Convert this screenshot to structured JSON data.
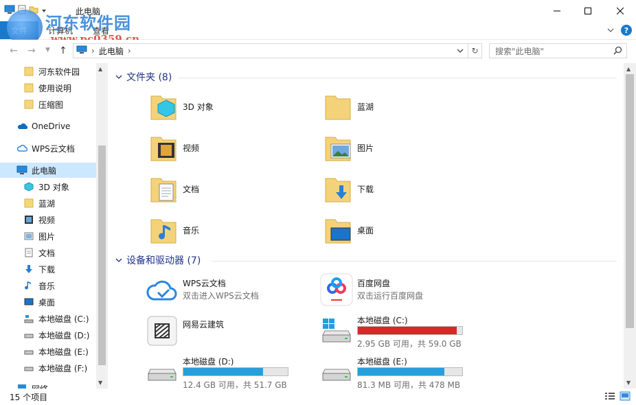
{
  "window": {
    "title": "此电脑"
  },
  "ribbon": {
    "file_tab": "文件",
    "tabs": [
      "计算机",
      "查看"
    ]
  },
  "watermark": {
    "name": "河东软件园",
    "url": "www.pc0359.cn"
  },
  "address": {
    "crumb": "此电脑",
    "search_placeholder": "搜索\"此电脑\""
  },
  "sidebar": {
    "items": [
      {
        "label": "河东软件园",
        "icon": "folder-icon"
      },
      {
        "label": "使用说明",
        "icon": "folder-icon"
      },
      {
        "label": "压缩图",
        "icon": "folder-icon"
      },
      {
        "label": "OneDrive",
        "icon": "onedrive-icon"
      },
      {
        "label": "WPS云文档",
        "icon": "wps-cloud-icon"
      },
      {
        "label": "此电脑",
        "icon": "computer-icon"
      },
      {
        "label": "3D 对象",
        "icon": "3d-objects-icon"
      },
      {
        "label": "蓝湖",
        "icon": "folder-icon"
      },
      {
        "label": "视频",
        "icon": "videos-icon"
      },
      {
        "label": "图片",
        "icon": "pictures-icon"
      },
      {
        "label": "文档",
        "icon": "documents-icon"
      },
      {
        "label": "下载",
        "icon": "downloads-icon"
      },
      {
        "label": "音乐",
        "icon": "music-icon"
      },
      {
        "label": "桌面",
        "icon": "desktop-icon"
      },
      {
        "label": "本地磁盘 (C:)",
        "icon": "drive-c-icon"
      },
      {
        "label": "本地磁盘 (D:)",
        "icon": "drive-icon"
      },
      {
        "label": "本地磁盘 (E:)",
        "icon": "drive-icon"
      },
      {
        "label": "本地磁盘 (F:)",
        "icon": "drive-icon"
      },
      {
        "label": "网络",
        "icon": "network-icon"
      }
    ]
  },
  "folders_group": {
    "title": "文件夹 (8)",
    "items": [
      {
        "label": "3D 对象",
        "icon": "3d-objects-icon"
      },
      {
        "label": "蓝湖",
        "icon": "folder-icon"
      },
      {
        "label": "视频",
        "icon": "videos-icon"
      },
      {
        "label": "图片",
        "icon": "pictures-icon"
      },
      {
        "label": "文档",
        "icon": "documents-icon"
      },
      {
        "label": "下载",
        "icon": "downloads-icon"
      },
      {
        "label": "音乐",
        "icon": "music-icon"
      },
      {
        "label": "桌面",
        "icon": "desktop-icon"
      }
    ]
  },
  "devices_group": {
    "title": "设备和驱动器 (7)",
    "items": [
      {
        "name": "WPS云文档",
        "sub": "双击进入WPS云文档",
        "icon": "wps-cloud-icon"
      },
      {
        "name": "百度网盘",
        "sub": "双击运行百度网盘",
        "icon": "baidu-netdisk-icon"
      },
      {
        "name": "网易云建筑",
        "sub": "",
        "icon": "netease-architecture-icon"
      },
      {
        "name": "本地磁盘 (C:)",
        "sub": "2.95 GB 可用，共 59.0 GB",
        "icon": "windows-drive-icon",
        "used_fraction": 0.95,
        "bar_color": "#da2626"
      },
      {
        "name": "本地磁盘 (D:)",
        "sub": "12.4 GB 可用，共 51.7 GB",
        "icon": "drive-icon",
        "used_fraction": 0.76,
        "bar_color": "#26a0da"
      },
      {
        "name": "本地磁盘 (E:)",
        "sub": "81.3 MB 可用，共 478 MB",
        "icon": "drive-icon",
        "used_fraction": 0.83,
        "bar_color": "#26a0da"
      }
    ]
  },
  "status": {
    "count": "15 个项目"
  }
}
